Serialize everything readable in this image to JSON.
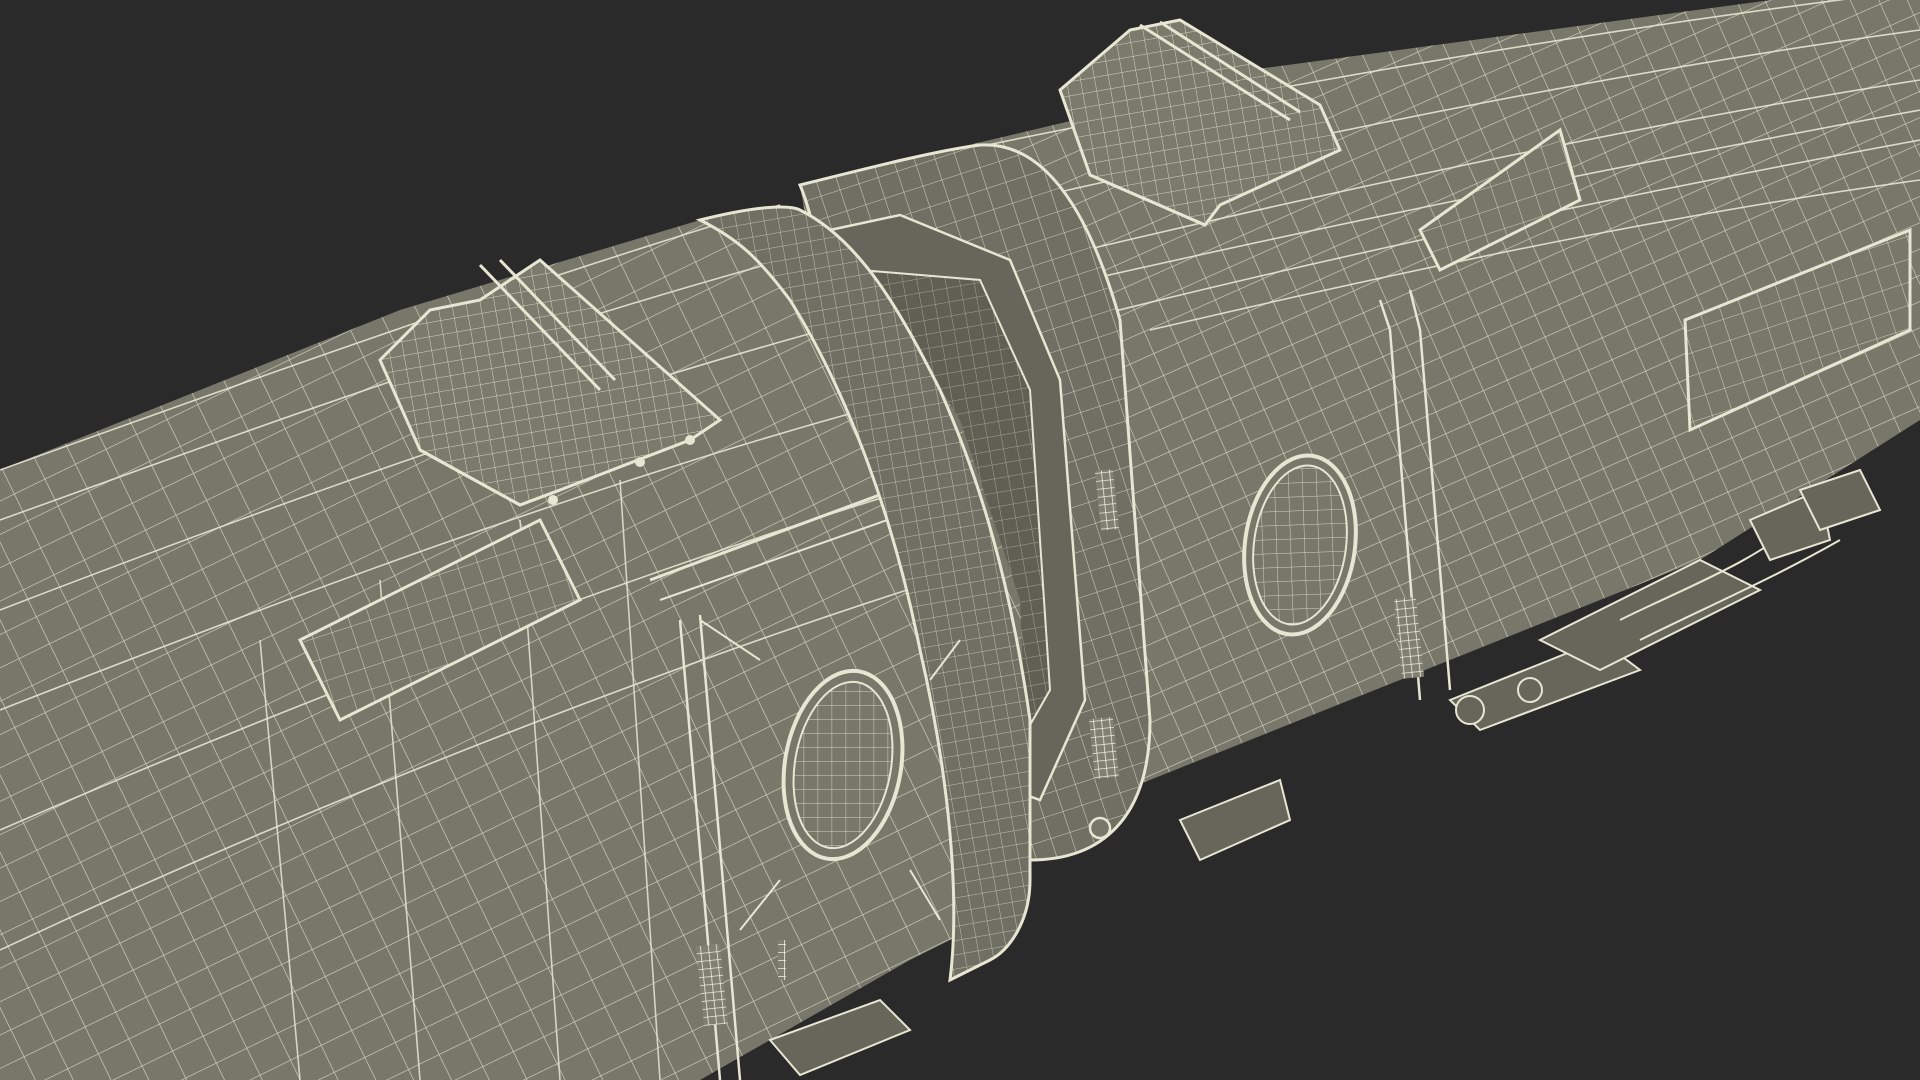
{
  "scene": {
    "background_color": "#2a2a2a",
    "surface_color": "#77776a",
    "wire_color": "#e6e6d2",
    "shadow_color": "#5f5f53",
    "grille_color": "#d9d9c6"
  }
}
